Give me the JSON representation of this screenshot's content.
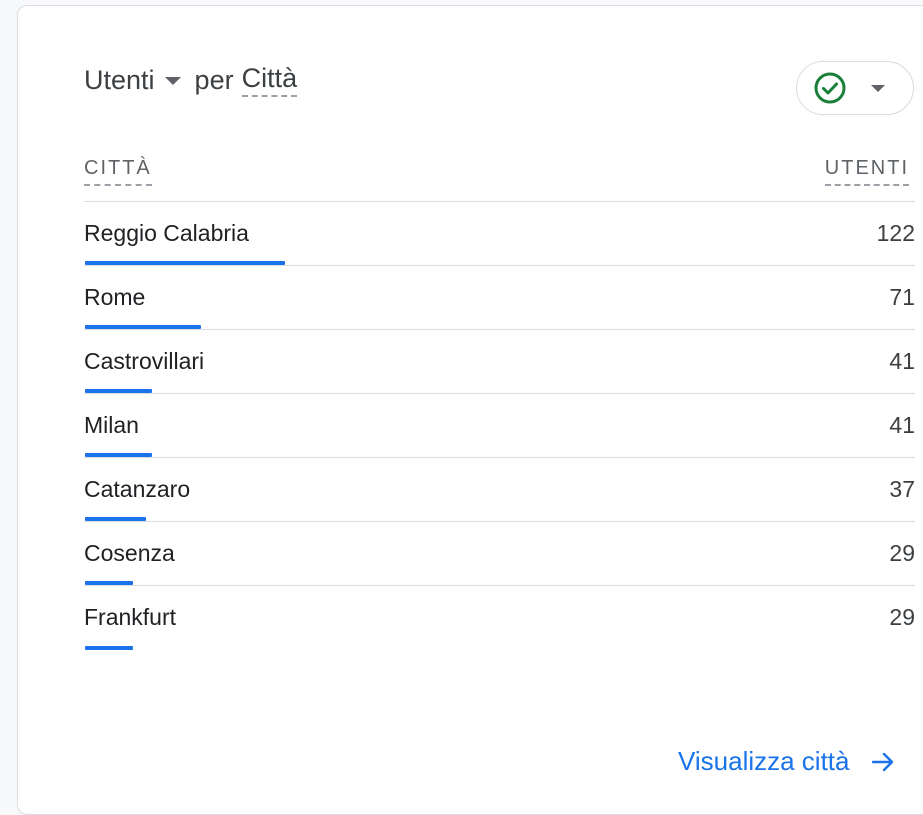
{
  "card": {
    "metric_label": "Utenti",
    "by_label": "per",
    "dimension_label": "Città",
    "status_color": "#188038",
    "status_icon": "check-circle-icon"
  },
  "table": {
    "col_city": "CITTÀ",
    "col_users": "UTENTI",
    "max_value": 122,
    "bar_color": "#1a73e8",
    "rows": [
      {
        "city": "Reggio Calabria",
        "users": "122",
        "value": 122
      },
      {
        "city": "Rome",
        "users": "71",
        "value": 71
      },
      {
        "city": "Castrovillari",
        "users": "41",
        "value": 41
      },
      {
        "city": "Milan",
        "users": "41",
        "value": 41
      },
      {
        "city": "Catanzaro",
        "users": "37",
        "value": 37
      },
      {
        "city": "Cosenza",
        "users": "29",
        "value": 29
      },
      {
        "city": "Frankfurt",
        "users": "29",
        "value": 29
      }
    ]
  },
  "footer": {
    "link_label": "Visualizza città",
    "arrow_icon": "arrow-right-icon"
  }
}
